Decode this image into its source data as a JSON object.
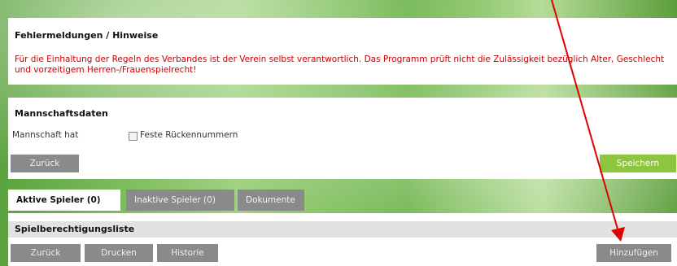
{
  "errors": {
    "title": "Fehlermeldungen / Hinweise",
    "message": "Für die Einhaltung der Regeln des Verbandes ist der Verein selbst verantwortlich. Das Programm prüft nicht die Zulässigkeit bezüglich Alter, Geschlecht und vorzeitigem Herren-/Frauenspielrecht!"
  },
  "team": {
    "title": "Mannschaftsdaten",
    "has_label": "Mannschaft hat",
    "checkbox_label": "Feste Rückennummern",
    "checkbox_checked": false,
    "back_button": "Zurück",
    "save_button": "Speichern"
  },
  "tabs": [
    {
      "label": "Aktive Spieler (0)",
      "active": true
    },
    {
      "label": "Inaktive Spieler (0)",
      "active": false
    },
    {
      "label": "Dokumente",
      "active": false
    }
  ],
  "list": {
    "title": "Spielberechtigungsliste",
    "back_button": "Zurück",
    "print_button": "Drucken",
    "history_button": "Historie",
    "add_button": "Hinzufügen"
  },
  "colors": {
    "accent_green": "#8cc63f",
    "button_gray": "#8a8a8a",
    "error_red": "#cc0000",
    "annotation_red": "#e00000"
  }
}
